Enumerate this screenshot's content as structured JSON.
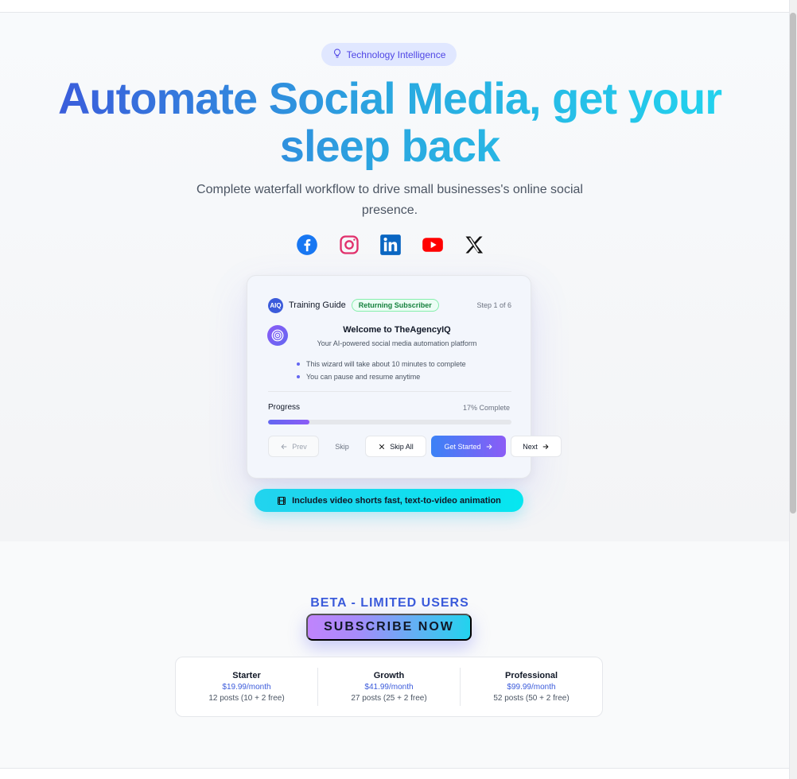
{
  "badge": {
    "label": "Technology Intelligence",
    "icon": "lightbulb-icon"
  },
  "hero": {
    "headline": "Automate Social Media, get your sleep back",
    "subtitle": "Complete waterfall workflow to drive small businesses's online social presence."
  },
  "social": [
    "facebook-icon",
    "instagram-icon",
    "linkedin-icon",
    "youtube-icon",
    "x-icon"
  ],
  "guide": {
    "logo": "AIQ",
    "title": "Training Guide",
    "badge": "Returning Subscriber",
    "step": "Step 1 of 6",
    "welcome_title": "Welcome to TheAgencyIQ",
    "welcome_sub": "Your AI-powered social media automation platform",
    "bullets": [
      "This wizard will take about 10 minutes to complete",
      "You can pause and resume anytime"
    ],
    "progress_label": "Progress",
    "progress_text": "17% Complete",
    "progress_value": 0.17,
    "buttons": {
      "prev": "Prev",
      "skip": "Skip",
      "skip_all": "Skip All",
      "get_started": "Get Started",
      "next": "Next"
    }
  },
  "video_pill": "Includes video shorts fast, text-to-video animation",
  "pricing": {
    "beta": "BETA - LIMITED USERS",
    "subscribe": "SUBSCRIBE NOW",
    "plans": [
      {
        "name": "Starter",
        "price": "$19.99/month",
        "posts": "12 posts (10 + 2 free)"
      },
      {
        "name": "Growth",
        "price": "$41.99/month",
        "posts": "27 posts (25 + 2 free)"
      },
      {
        "name": "Professional",
        "price": "$99.99/month",
        "posts": "52 posts (50 + 2 free)"
      }
    ]
  },
  "colors": {
    "accent": "#3b5bdb",
    "cyan": "#22d3ee",
    "purple": "#8b5cf6",
    "success": "#15803d"
  }
}
